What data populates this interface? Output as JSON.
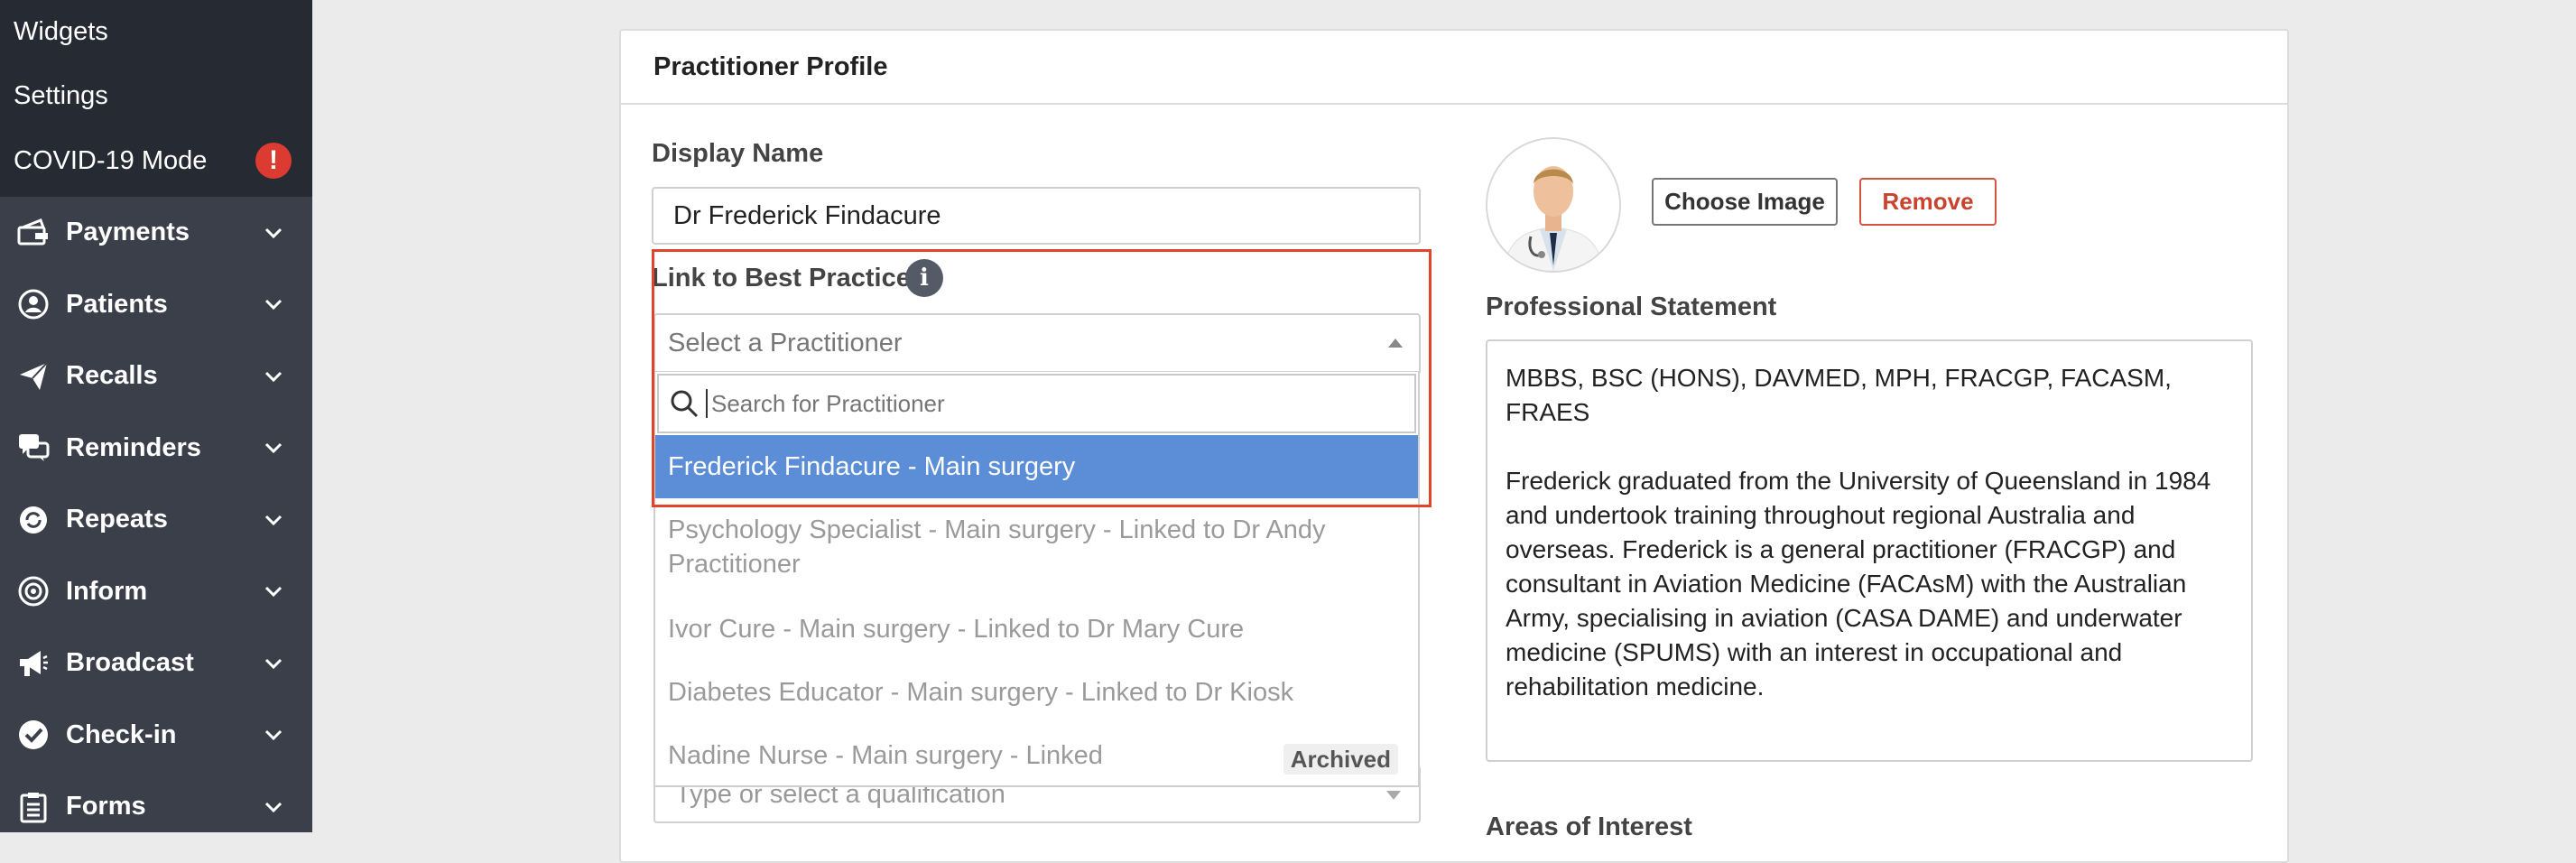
{
  "sidebar": {
    "sub_items": [
      {
        "label": "Widgets"
      },
      {
        "label": "Settings"
      },
      {
        "label": "COVID-19 Mode",
        "badge": "!"
      }
    ],
    "nav_items": [
      {
        "label": "Payments",
        "icon": "payments-icon"
      },
      {
        "label": "Patients",
        "icon": "patients-icon"
      },
      {
        "label": "Recalls",
        "icon": "recalls-icon"
      },
      {
        "label": "Reminders",
        "icon": "reminders-icon"
      },
      {
        "label": "Repeats",
        "icon": "repeats-icon"
      },
      {
        "label": "Inform",
        "icon": "inform-icon"
      },
      {
        "label": "Broadcast",
        "icon": "broadcast-icon"
      },
      {
        "label": "Check-in",
        "icon": "check-in-icon"
      },
      {
        "label": "Forms",
        "icon": "forms-icon"
      }
    ]
  },
  "card": {
    "title": "Practitioner Profile",
    "display_name_label": "Display Name",
    "display_name_value": "Dr Frederick Findacure",
    "link_label": "Link to Best Practice",
    "select_placeholder": "Select a Practitioner",
    "search_placeholder": "Search for Practitioner",
    "options": [
      {
        "label": "Frederick Findacure - Main surgery",
        "selected": true
      },
      {
        "label": "Psychology Specialist - Main surgery - Linked to Dr Andy Practitioner"
      },
      {
        "label": "Ivor Cure - Main surgery - Linked to Dr Mary Cure"
      },
      {
        "label": "Diabetes Educator - Main surgery - Linked to Dr Kiosk"
      },
      {
        "label": "Nadine Nurse - Main surgery - Linked",
        "badge": "Archived"
      }
    ],
    "qualification_placeholder": "Type or select a qualification",
    "choose_image_label": "Choose Image",
    "remove_label": "Remove",
    "statement_label": "Professional Statement",
    "statement_line1": "MBBS, BSC (HONS), DAVMED, MPH, FRACGP, FACASM, FRAES",
    "statement_body": "Frederick graduated from the University of Queensland in 1984 and undertook training throughout regional Australia and overseas. Frederick is a general practitioner (FRACGP) and consultant in Aviation Medicine (FACAsM) with the Australian Army, specialising in aviation (CASA DAME) and underwater medicine (SPUMS) with an interest in occupational and rehabilitation medicine.",
    "areas_label": "Areas of Interest"
  },
  "colors": {
    "sidebar": "#3a3f4a",
    "sidebar_sub": "#262a32",
    "selected": "#5b8ed6",
    "danger": "#dc3b32",
    "highlight": "#e0452c"
  }
}
